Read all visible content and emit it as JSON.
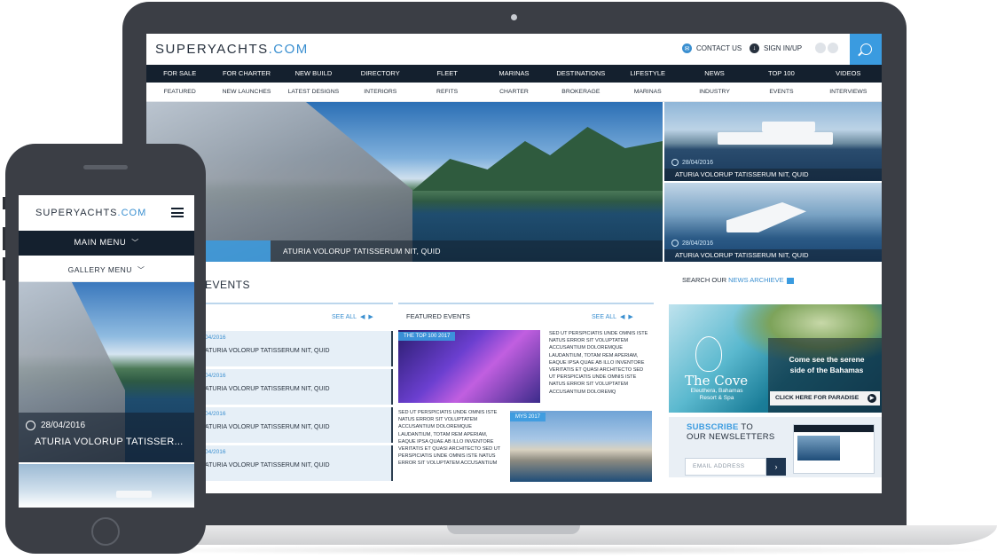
{
  "site": {
    "logo_main": "SUPERYACHTS",
    "logo_com": ".COM"
  },
  "header": {
    "contact": "CONTACT US",
    "signin": "SIGN IN/UP"
  },
  "main_nav": [
    "FOR SALE",
    "FOR CHARTER",
    "NEW BUILD",
    "DIRECTORY",
    "FLEET",
    "MARINAS",
    "DESTINATIONS",
    "LIFESTYLE",
    "NEWS",
    "TOP 100",
    "VIDEOS"
  ],
  "sub_nav": [
    "FEATURED",
    "NEW LAUNCHES",
    "LATEST DESIGNS",
    "INTERIORS",
    "REFITS",
    "CHARTER",
    "BROKERAGE",
    "MARINAS",
    "INDUSTRY",
    "EVENTS",
    "INTERVIEWS"
  ],
  "hero": {
    "caption": "ATURIA VOLORUP TATISSERUM NIT, QUID"
  },
  "side_cards": [
    {
      "date": "28/04/2016",
      "caption": "ATURIA VOLORUP TATISSERUM NIT, QUID"
    },
    {
      "date": "28/04/2016",
      "caption": "ATURIA VOLORUP TATISSERUM NIT, QUID"
    }
  ],
  "events": {
    "title": "EVENTS",
    "see_all": "SEE ALL",
    "rows": [
      {
        "date": "04/2016",
        "title": "ATURIA VOLORUP TATISSERUM NIT, QUID"
      },
      {
        "date": "04/2016",
        "title": "ATURIA VOLORUP TATISSERUM NIT, QUID"
      },
      {
        "date": "04/2016",
        "title": "ATURIA VOLORUP TATISSERUM NIT, QUID"
      },
      {
        "date": "04/2016",
        "title": "ATURIA VOLORUP TATISSERUM NIT, QUID"
      }
    ]
  },
  "featured": {
    "title": "FEATURED EVENTS",
    "see_all": "SEE ALL",
    "tag1": "THE TOP 100 2017",
    "tag2": "MYS 2017",
    "text1": "SED UT PERSPICIATIS UNDE OMNIS ISTE NATUS ERROR SIT VOLUPTATEM ACCUSANTIUM DOLOREMQUE LAUDANTIUM, TOTAM REM APERIAM, EAQUE IPSA QUAE AB ILLO INVENTORE VERITATIS ET QUASI ARCHITECTO SED UT PERSPICIATIS UNDE OMNIS ISTE NATUS ERROR SIT VOLUPTATEM ACCUSANTIUM DOLOREMQ",
    "text2": "SED UT PERSPICIATIS UNDE OMNIS ISTE NATUS ERROR SIT VOLUPTATEM ACCUSANTIUM DOLOREMQUE LAUDANTIUM, TOTAM REM APERIAM, EAQUE IPSA QUAE AB ILLO INVENTORE VERITATIS ET QUASI ARCHITECTO SED UT PERSPICIATIS UNDE OMNIS ISTE NATUS ERROR SIT VOLUPTATEM ACCUSANTIUM DOLOREMQ"
  },
  "news_search": {
    "prefix": "SEARCH OUR ",
    "link": "NEWS ARCHIEVE"
  },
  "ad": {
    "brand": "The Cove",
    "brand_sub": "Eleuthera, Bahamas Resort & Spa",
    "message": "Come see the serene side of the Bahamas",
    "cta": "CLICK HERE FOR PARADISE"
  },
  "newsletter": {
    "subscribe": "SUBSCRIBE",
    "to": " TO",
    "line2": "OUR NEWSLETTERS",
    "placeholder": "EMAIL ADDRESS",
    "go": "›"
  },
  "mobile": {
    "main_menu": "MAIN MENU",
    "gallery_menu": "GALLERY MENU",
    "date": "28/04/2016",
    "title": "ATURIA VOLORUP TATISSER..."
  },
  "colors": {
    "navy": "#14202e",
    "accent": "#3a9be0"
  },
  "icons": [
    "speech-icon",
    "user-icon",
    "search-icon",
    "clock-icon",
    "menu-icon",
    "chevron-down-icon",
    "arrow-right-icon"
  ]
}
